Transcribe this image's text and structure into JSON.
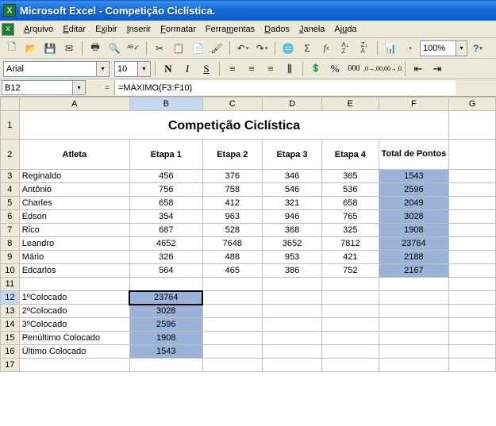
{
  "window": {
    "title": "Microsoft Excel - Competição Ciclística."
  },
  "menus": {
    "arquivo": "Arquivo",
    "editar": "Editar",
    "exibir": "Exibir",
    "inserir": "Inserir",
    "formatar": "Formatar",
    "ferramentas": "Ferramentas",
    "dados": "Dados",
    "janela": "Janela",
    "ajuda": "Ajuda"
  },
  "format": {
    "font": "Arial",
    "size": "10"
  },
  "zoom": "100%",
  "namebox": "B12",
  "formula": "=MÁXIMO(F3:F10)",
  "columns": [
    "A",
    "B",
    "C",
    "D",
    "E",
    "F",
    "G"
  ],
  "sheet": {
    "title": "Competição Ciclística",
    "headers": {
      "atleta": "Atleta",
      "e1": "Etapa 1",
      "e2": "Etapa 2",
      "e3": "Etapa 3",
      "e4": "Etapa 4",
      "total": "Total de Pontos"
    },
    "rows": [
      {
        "name": "Reginaldo",
        "e1": "456",
        "e2": "376",
        "e3": "346",
        "e4": "365",
        "total": "1543"
      },
      {
        "name": "Antônio",
        "e1": "756",
        "e2": "758",
        "e3": "546",
        "e4": "536",
        "total": "2596"
      },
      {
        "name": "Charles",
        "e1": "658",
        "e2": "412",
        "e3": "321",
        "e4": "658",
        "total": "2049"
      },
      {
        "name": "Edson",
        "e1": "354",
        "e2": "963",
        "e3": "946",
        "e4": "765",
        "total": "3028"
      },
      {
        "name": "Rico",
        "e1": "687",
        "e2": "528",
        "e3": "368",
        "e4": "325",
        "total": "1908"
      },
      {
        "name": "Leandro",
        "e1": "4652",
        "e2": "7648",
        "e3": "3652",
        "e4": "7812",
        "total": "23764"
      },
      {
        "name": "Mário",
        "e1": "326",
        "e2": "488",
        "e3": "953",
        "e4": "421",
        "total": "2188"
      },
      {
        "name": "Edcarlos",
        "e1": "564",
        "e2": "465",
        "e3": "386",
        "e4": "752",
        "total": "2167"
      }
    ],
    "ranking": [
      {
        "label": "1ºColocado",
        "value": "23764"
      },
      {
        "label": "2ºColocado",
        "value": "3028"
      },
      {
        "label": "3ºColocado",
        "value": "2596"
      },
      {
        "label": "Penúltimo Colocado",
        "value": "1908"
      },
      {
        "label": "Último Colocado",
        "value": "1543"
      }
    ]
  },
  "row_nums": [
    "1",
    "2",
    "3",
    "4",
    "5",
    "6",
    "7",
    "8",
    "9",
    "10",
    "11",
    "12",
    "13",
    "14",
    "15",
    "16",
    "17"
  ]
}
